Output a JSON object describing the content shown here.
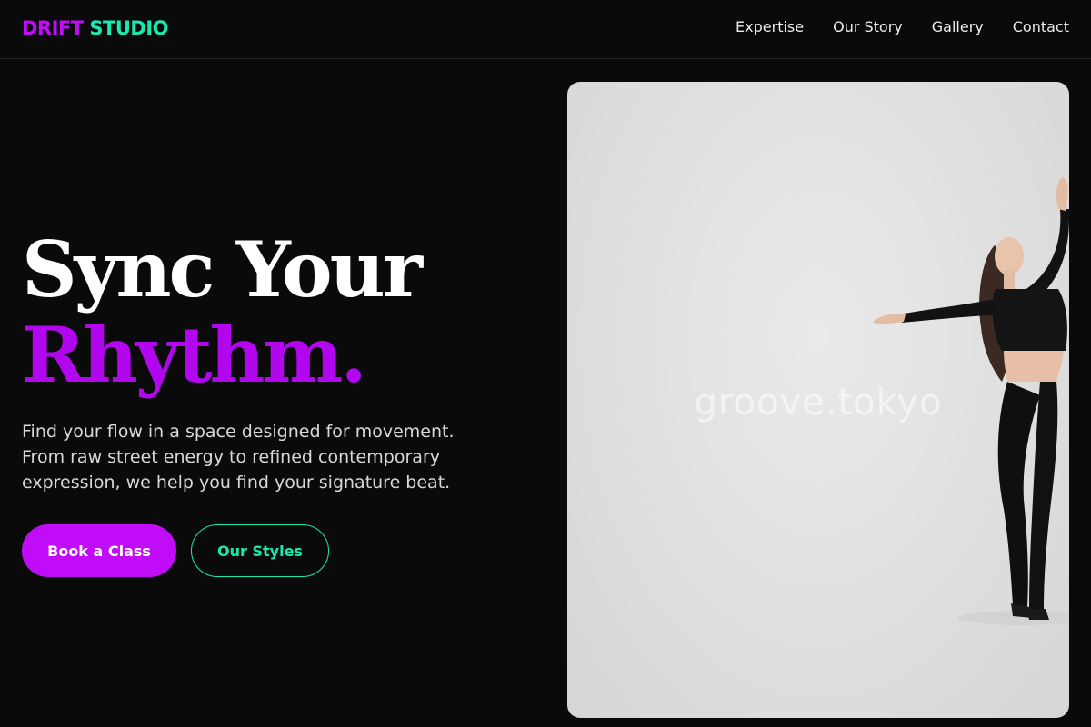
{
  "brand": {
    "part1": "DRIFT",
    "part2": "STUDIO"
  },
  "nav": {
    "items": [
      "Expertise",
      "Our Story",
      "Gallery",
      "Contact"
    ]
  },
  "hero": {
    "title_line1": "Sync Your",
    "title_line2": "Rhythm.",
    "description": "Find your flow in a space designed for movement. From raw street energy to refined contemporary expression, we help you find your signature beat.",
    "primary_button": "Book a Class",
    "secondary_button": "Our Styles"
  },
  "photo": {
    "watermark": "groove.tokyo",
    "subject": "dancer-photo"
  },
  "colors": {
    "background": "#0a0a0b",
    "accent_purple": "#c10cf7",
    "accent_teal": "#19e9b0"
  }
}
